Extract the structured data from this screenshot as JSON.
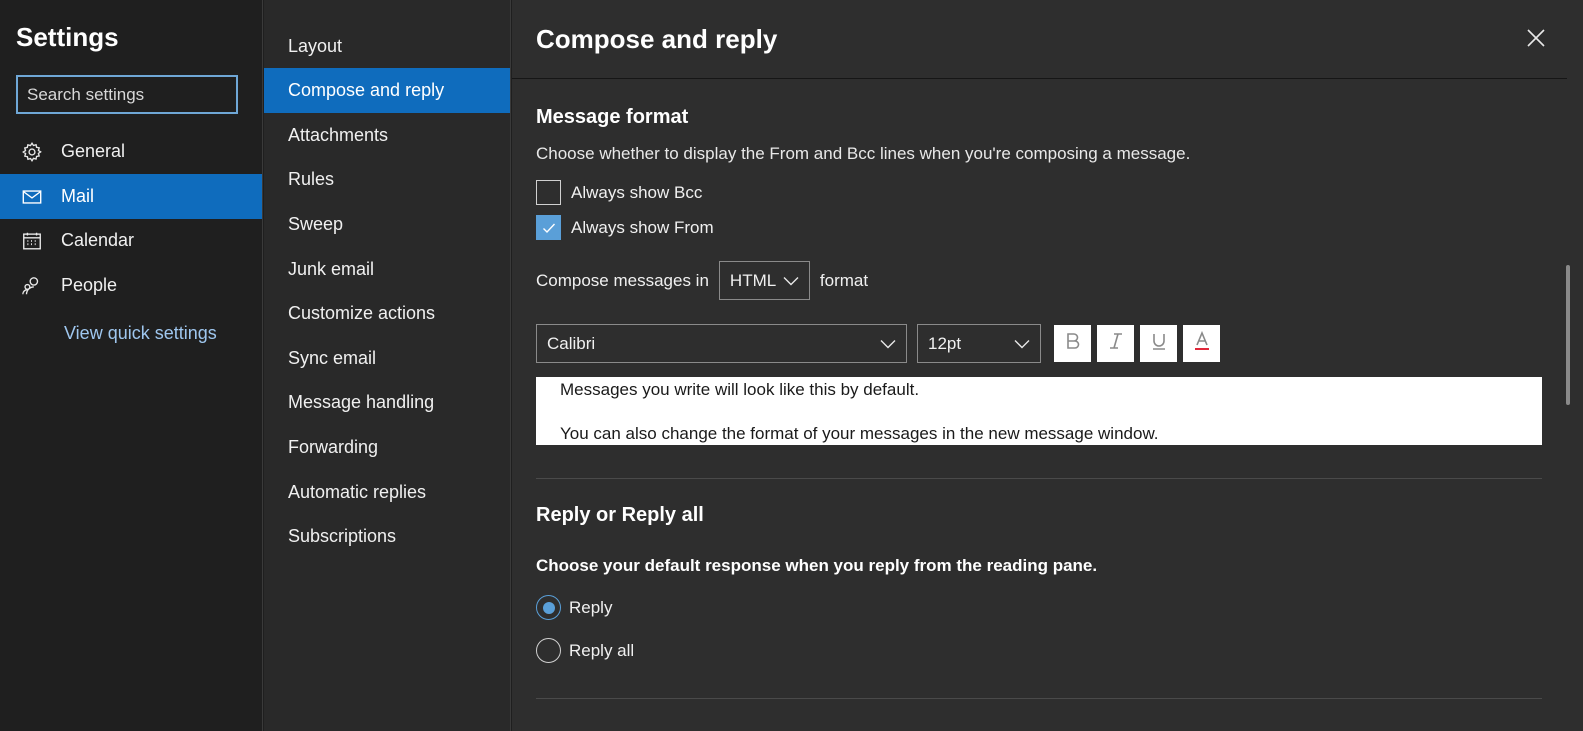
{
  "settings": {
    "title": "Settings",
    "search_placeholder": "Search settings",
    "nav": [
      {
        "label": "General",
        "icon": "gear-icon"
      },
      {
        "label": "Mail",
        "icon": "mail-icon",
        "active": true
      },
      {
        "label": "Calendar",
        "icon": "calendar-icon"
      },
      {
        "label": "People",
        "icon": "people-icon"
      }
    ],
    "quick_settings_link": "View quick settings"
  },
  "mail_sections": [
    {
      "label": "Layout"
    },
    {
      "label": "Compose and reply",
      "active": true
    },
    {
      "label": "Attachments"
    },
    {
      "label": "Rules"
    },
    {
      "label": "Sweep"
    },
    {
      "label": "Junk email"
    },
    {
      "label": "Customize actions"
    },
    {
      "label": "Sync email"
    },
    {
      "label": "Message handling"
    },
    {
      "label": "Forwarding"
    },
    {
      "label": "Automatic replies"
    },
    {
      "label": "Subscriptions"
    }
  ],
  "panel": {
    "title": "Compose and reply",
    "message_format": {
      "title": "Message format",
      "description": "Choose whether to display the From and Bcc lines when you're composing a message.",
      "always_show_bcc": {
        "label": "Always show Bcc",
        "checked": false
      },
      "always_show_from": {
        "label": "Always show From",
        "checked": true
      },
      "compose_prefix": "Compose messages in",
      "compose_format": "HTML",
      "compose_suffix": "format",
      "font": "Calibri",
      "size": "12pt",
      "format_buttons": [
        "bold-icon",
        "italic-icon",
        "underline-icon",
        "font-color-icon"
      ],
      "preview_line1": "Messages you write will look like this by default.",
      "preview_line2": "You can also change the format of your messages in the new message window."
    },
    "reply": {
      "title": "Reply or Reply all",
      "description": "Choose your default response when you reply from the reading pane.",
      "options": [
        {
          "label": "Reply",
          "selected": true
        },
        {
          "label": "Reply all",
          "selected": false
        }
      ]
    }
  },
  "colors": {
    "accent": "#0f6cbd",
    "checkbox_accent": "#5a9fd8",
    "link": "#9fc7ef",
    "font_color_underline": "#e0283a"
  }
}
